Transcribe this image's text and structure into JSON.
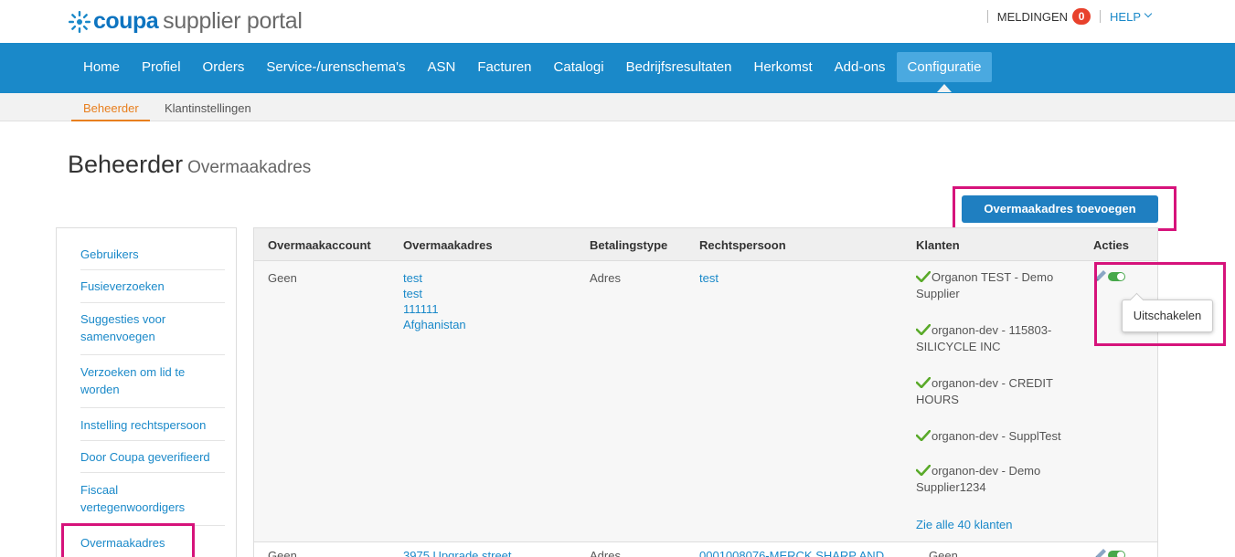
{
  "header": {
    "logo_brand": "coupa",
    "logo_rest": "supplier portal",
    "notifications_label": "MELDINGEN",
    "notifications_count": "0",
    "help_label": "HELP"
  },
  "mainnav": {
    "items": [
      "Home",
      "Profiel",
      "Orders",
      "Service-/urenschema's",
      "ASN",
      "Facturen",
      "Catalogi",
      "Bedrijfsresultaten",
      "Herkomst",
      "Add-ons",
      "Configuratie"
    ],
    "active": "Configuratie"
  },
  "subnav": {
    "active": "Beheerder",
    "other": "Klantinstellingen"
  },
  "page": {
    "title": "Beheerder",
    "subtitle": "Overmaakadres",
    "add_button": "Overmaakadres toevoegen"
  },
  "sidebar": {
    "items": [
      "Gebruikers",
      "Fusieverzoeken",
      "Suggesties voor samenvoegen",
      "Verzoeken om lid te worden",
      "Instelling rechtspersoon",
      "Door Coupa geverifieerd",
      "Fiscaal vertegenwoordigers",
      "Overmaakadres"
    ],
    "active": "Overmaakadres"
  },
  "table": {
    "headers": [
      "Overmaakaccount",
      "Overmaakadres",
      "Betalingstype",
      "Rechtspersoon",
      "Klanten",
      "Acties"
    ],
    "rows": [
      {
        "account": "Geen",
        "address": [
          "test",
          "test",
          "111111",
          "Afghanistan"
        ],
        "payment_type": "Adres",
        "legal_entity": "test",
        "customers": [
          "Organon TEST - Demo Supplier",
          "organon-dev - 115803-SILICYCLE INC",
          "organon-dev - CREDIT HOURS",
          "organon-dev - SupplTest",
          "organon-dev - Demo Supplier1234"
        ],
        "see_all": "Zie alle 40 klanten"
      },
      {
        "account": "Geen",
        "address": [
          "3975 Upgrade street"
        ],
        "payment_type": "Adres",
        "legal_entity": "0001008076-MERCK SHARP AND",
        "customers_text": "Geen"
      }
    ]
  },
  "tooltip": "Uitschakelen",
  "colors": {
    "nav_blue": "#1a89c9",
    "active_tab": "#4aa9e0",
    "accent_orange": "#e87f1e",
    "highlight": "#d6137b",
    "check_green": "#5aaa2a"
  }
}
